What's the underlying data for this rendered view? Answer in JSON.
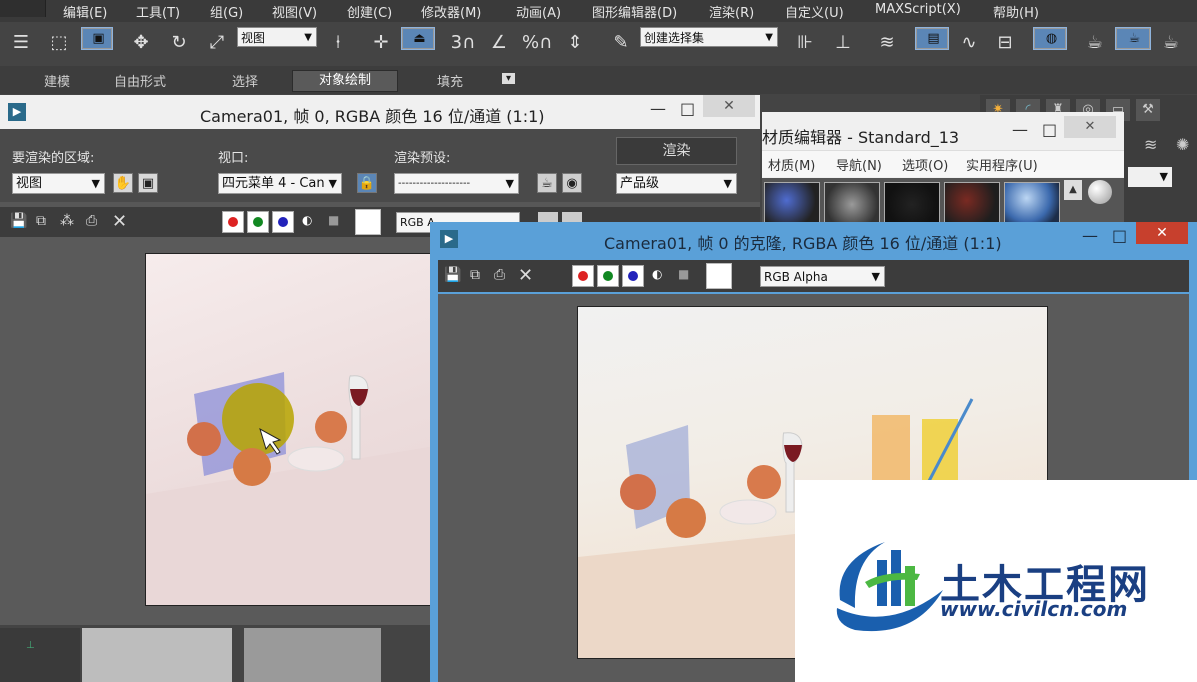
{
  "menu": [
    "编辑(E)",
    "工具(T)",
    "组(G)",
    "视图(V)",
    "创建(C)",
    "修改器(M)",
    "动画(A)",
    "图形编辑器(D)",
    "渲染(R)",
    "自定义(U)",
    "MAXScript(X)",
    "帮助(H)"
  ],
  "toolbar": {
    "view_select": "视图",
    "selection_set": "创建选择集",
    "snap_label": "3",
    "percent_snap": "%"
  },
  "ribbon": [
    "建模",
    "自由形式",
    "选择",
    "对象绘制",
    "填充"
  ],
  "render_frame": {
    "title": "Camera01, 帧 0, RGBA 颜色 16 位/通道 (1:1)",
    "area_label": "要渲染的区域:",
    "area_value": "视图",
    "viewport_label": "视口:",
    "viewport_value": "四元菜单 4 - Can",
    "preset_label": "渲染预设:",
    "preset_value": "--------------------",
    "render_button": "渲染",
    "quality_value": "产品级",
    "channel_value": "RGB A"
  },
  "material_editor": {
    "title": "材质编辑器 - Standard_13",
    "menu": [
      "材质(M)",
      "导航(N)",
      "选项(O)",
      "实用程序(U)"
    ]
  },
  "clone_window": {
    "title": "Camera01, 帧 0 的克隆, RGBA 颜色 16 位/通道 (1:1)",
    "channel_value": "RGB Alpha"
  },
  "window_controls": {
    "minimize": "—",
    "maximize": "□",
    "close": "✕"
  },
  "watermark": {
    "name": "土木工程网",
    "url": "www.civilcn.com"
  },
  "colors": {
    "accent_blue": "#5aa0d8",
    "close_red": "#c7402d",
    "toolbar_bg": "#444444",
    "watermark_blue": "#1a5fae",
    "watermark_green": "#4cb843"
  }
}
